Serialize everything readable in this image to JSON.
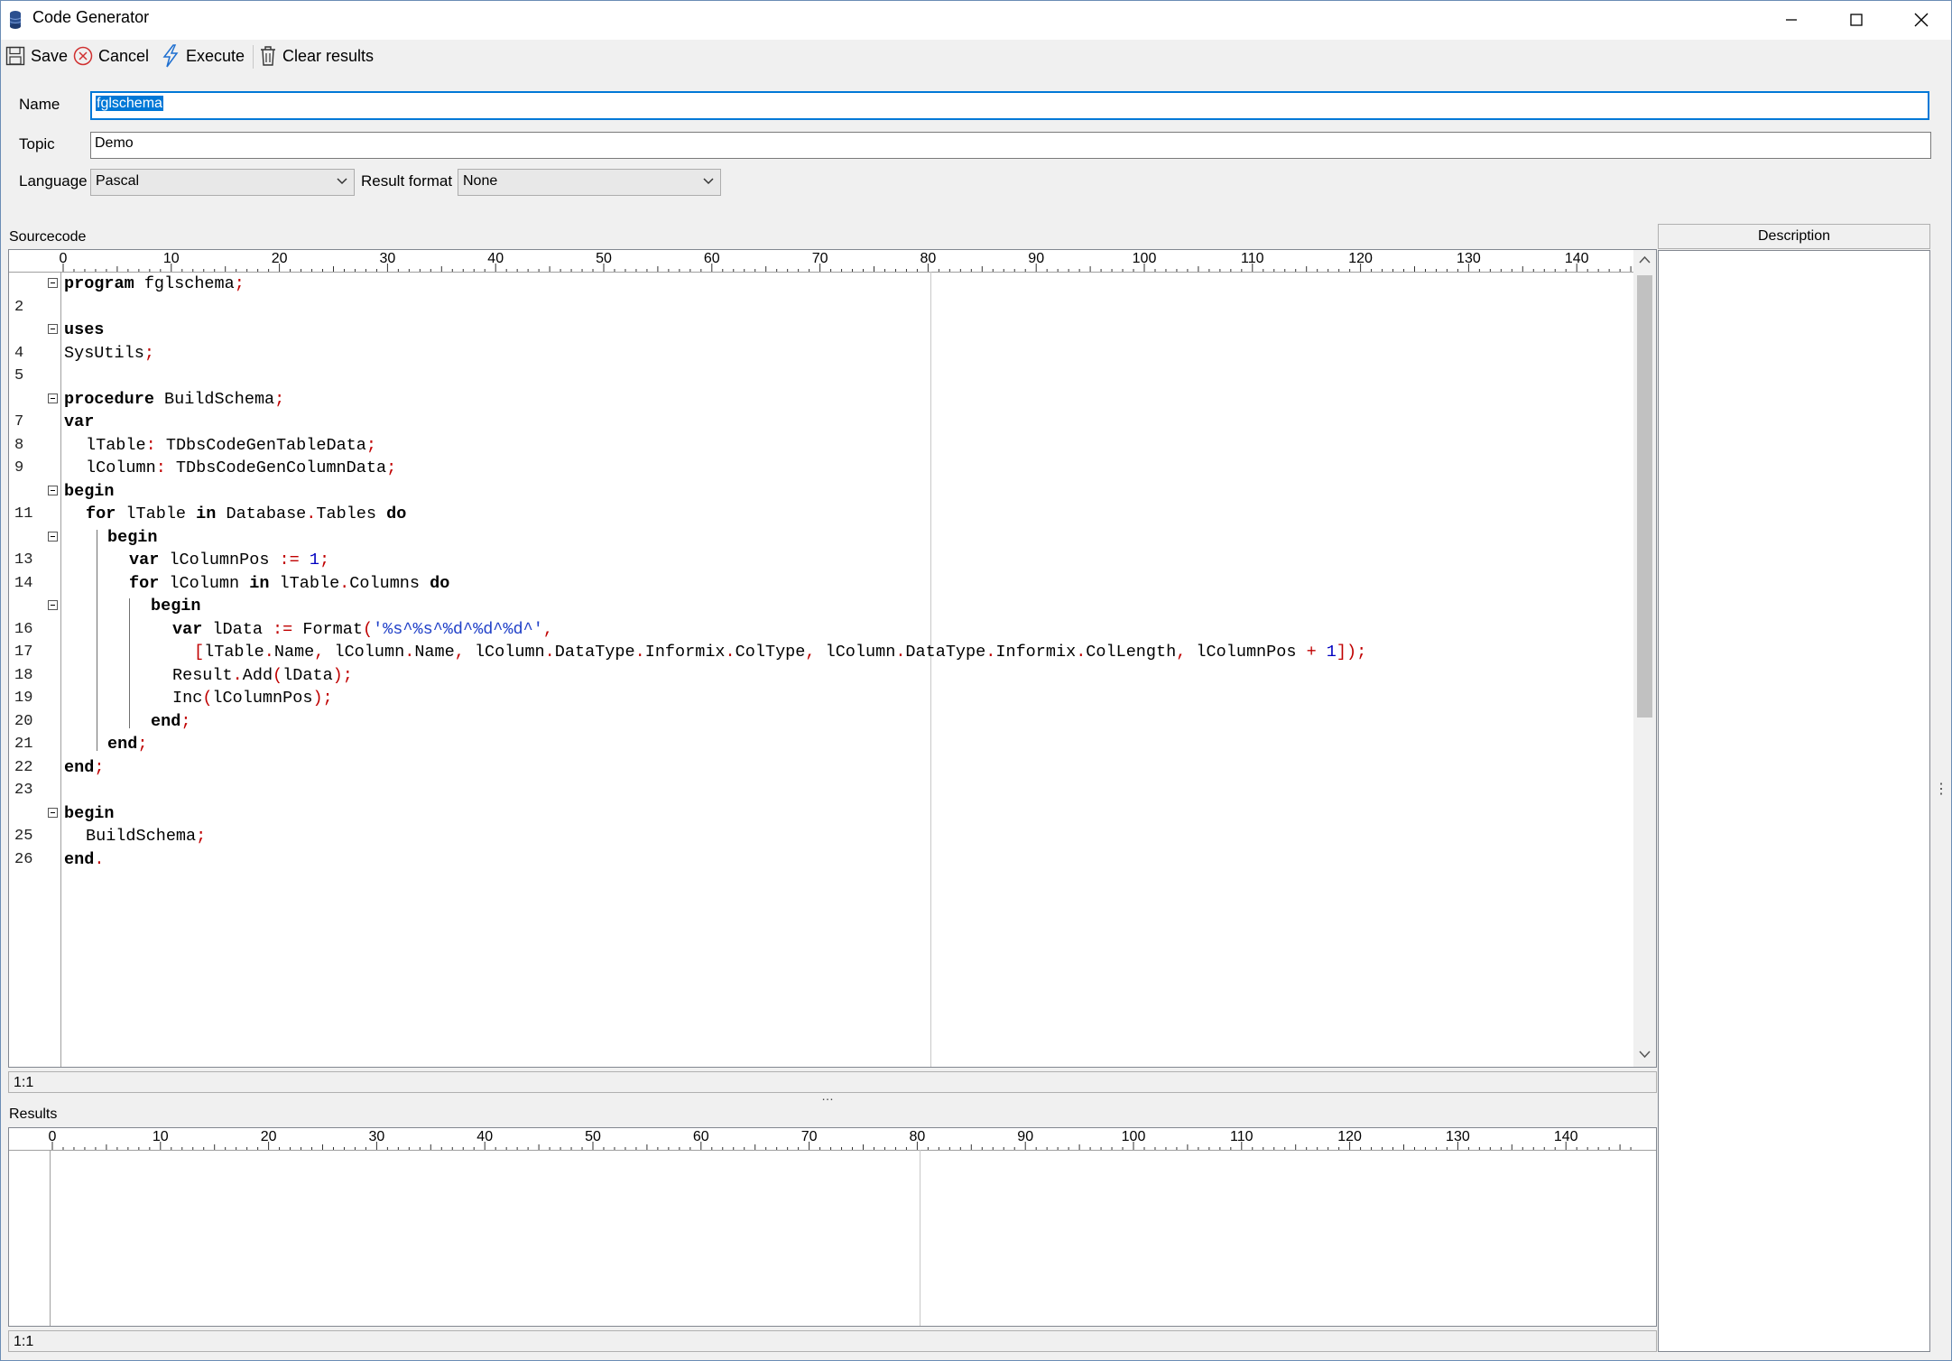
{
  "window": {
    "title": "Code Generator",
    "minimize_glyph": "—",
    "maximize_glyph": "☐",
    "close_glyph": "✕"
  },
  "toolbar": {
    "save_label": "Save",
    "cancel_label": "Cancel",
    "execute_label": "Execute",
    "clear_label": "Clear results"
  },
  "form": {
    "name_label": "Name",
    "name_value": "fglschema",
    "topic_label": "Topic",
    "topic_value": "Demo",
    "language_label": "Language",
    "language_value": "Pascal",
    "result_format_label": "Result format",
    "result_format_value": "None"
  },
  "source": {
    "label": "Sourcecode",
    "status": "1:1",
    "ruler_ticks": [
      "0",
      "10",
      "20",
      "30",
      "40",
      "50",
      "60",
      "70",
      "80",
      "90",
      "100",
      "110",
      "120",
      "130",
      "140"
    ],
    "lines": [
      {
        "n": "",
        "fold": true,
        "indent": 0,
        "tokens": [
          [
            "kw",
            "program"
          ],
          [
            "t",
            " fglschema"
          ],
          [
            "sym",
            ";"
          ]
        ]
      },
      {
        "n": "2",
        "fold": false,
        "indent": 0,
        "tokens": []
      },
      {
        "n": "",
        "fold": true,
        "indent": 0,
        "tokens": [
          [
            "kw",
            "uses"
          ]
        ]
      },
      {
        "n": "4",
        "fold": false,
        "indent": 0,
        "tokens": [
          [
            "t",
            "SysUtils"
          ],
          [
            "sym",
            ";"
          ]
        ]
      },
      {
        "n": "5",
        "fold": false,
        "indent": 0,
        "tokens": []
      },
      {
        "n": "",
        "fold": true,
        "indent": 0,
        "tokens": [
          [
            "kw",
            "procedure"
          ],
          [
            "t",
            " BuildSchema"
          ],
          [
            "sym",
            ";"
          ]
        ]
      },
      {
        "n": "7",
        "fold": false,
        "indent": 0,
        "tokens": [
          [
            "kw",
            "var"
          ]
        ]
      },
      {
        "n": "8",
        "fold": false,
        "indent": 2,
        "tokens": [
          [
            "t",
            "lTable"
          ],
          [
            "sym",
            ":"
          ],
          [
            "t",
            " TDbsCodeGenTableData"
          ],
          [
            "sym",
            ";"
          ]
        ]
      },
      {
        "n": "9",
        "fold": false,
        "indent": 2,
        "tokens": [
          [
            "t",
            "lColumn"
          ],
          [
            "sym",
            ":"
          ],
          [
            "t",
            " TDbsCodeGenColumnData"
          ],
          [
            "sym",
            ";"
          ]
        ]
      },
      {
        "n": "",
        "fold": true,
        "indent": 0,
        "tokens": [
          [
            "kw",
            "begin"
          ]
        ]
      },
      {
        "n": "11",
        "fold": false,
        "indent": 2,
        "tokens": [
          [
            "kw",
            "for"
          ],
          [
            "t",
            " lTable "
          ],
          [
            "kw",
            "in"
          ],
          [
            "t",
            " Database"
          ],
          [
            "sym",
            "."
          ],
          [
            "t",
            "Tables "
          ],
          [
            "kw",
            "do"
          ]
        ]
      },
      {
        "n": "",
        "fold": true,
        "indent": 4,
        "tokens": [
          [
            "kw",
            "begin"
          ]
        ]
      },
      {
        "n": "13",
        "fold": false,
        "indent": 6,
        "tokens": [
          [
            "kw",
            "var"
          ],
          [
            "t",
            " lColumnPos "
          ],
          [
            "sym",
            ":="
          ],
          [
            "t",
            " "
          ],
          [
            "num",
            "1"
          ],
          [
            "sym",
            ";"
          ]
        ]
      },
      {
        "n": "14",
        "fold": false,
        "indent": 6,
        "tokens": [
          [
            "kw",
            "for"
          ],
          [
            "t",
            " lColumn "
          ],
          [
            "kw",
            "in"
          ],
          [
            "t",
            " lTable"
          ],
          [
            "sym",
            "."
          ],
          [
            "t",
            "Columns "
          ],
          [
            "kw",
            "do"
          ]
        ]
      },
      {
        "n": "",
        "fold": true,
        "indent": 8,
        "tokens": [
          [
            "kw",
            "begin"
          ]
        ]
      },
      {
        "n": "16",
        "fold": false,
        "indent": 10,
        "tokens": [
          [
            "kw",
            "var"
          ],
          [
            "t",
            " lData "
          ],
          [
            "sym",
            ":="
          ],
          [
            "t",
            " Format"
          ],
          [
            "sym",
            "("
          ],
          [
            "str",
            "'%s^%s^%d^%d^%d^'"
          ],
          [
            "sym",
            ","
          ]
        ]
      },
      {
        "n": "17",
        "fold": false,
        "indent": 12,
        "tokens": [
          [
            "sym",
            "["
          ],
          [
            "t",
            "lTable"
          ],
          [
            "sym",
            "."
          ],
          [
            "t",
            "Name"
          ],
          [
            "sym",
            ","
          ],
          [
            "t",
            " lColumn"
          ],
          [
            "sym",
            "."
          ],
          [
            "t",
            "Name"
          ],
          [
            "sym",
            ","
          ],
          [
            "t",
            " lColumn"
          ],
          [
            "sym",
            "."
          ],
          [
            "t",
            "DataType"
          ],
          [
            "sym",
            "."
          ],
          [
            "t",
            "Informix"
          ],
          [
            "sym",
            "."
          ],
          [
            "t",
            "ColType"
          ],
          [
            "sym",
            ","
          ],
          [
            "t",
            " lColumn"
          ],
          [
            "sym",
            "."
          ],
          [
            "t",
            "DataType"
          ],
          [
            "sym",
            "."
          ],
          [
            "t",
            "Informix"
          ],
          [
            "sym",
            "."
          ],
          [
            "t",
            "ColLength"
          ],
          [
            "sym",
            ","
          ],
          [
            "t",
            " lColumnPos "
          ],
          [
            "sym",
            "+"
          ],
          [
            "t",
            " "
          ],
          [
            "num",
            "1"
          ],
          [
            "sym",
            "]);"
          ]
        ]
      },
      {
        "n": "18",
        "fold": false,
        "indent": 10,
        "tokens": [
          [
            "t",
            "Result"
          ],
          [
            "sym",
            "."
          ],
          [
            "t",
            "Add"
          ],
          [
            "sym",
            "("
          ],
          [
            "t",
            "lData"
          ],
          [
            "sym",
            ");"
          ]
        ]
      },
      {
        "n": "19",
        "fold": false,
        "indent": 10,
        "tokens": [
          [
            "t",
            "Inc"
          ],
          [
            "sym",
            "("
          ],
          [
            "t",
            "lColumnPos"
          ],
          [
            "sym",
            ");"
          ]
        ]
      },
      {
        "n": "20",
        "fold": false,
        "indent": 8,
        "tokens": [
          [
            "kw",
            "end"
          ],
          [
            "sym",
            ";"
          ]
        ]
      },
      {
        "n": "21",
        "fold": false,
        "indent": 4,
        "tokens": [
          [
            "kw",
            "end"
          ],
          [
            "sym",
            ";"
          ]
        ]
      },
      {
        "n": "22",
        "fold": false,
        "indent": 0,
        "tokens": [
          [
            "kw",
            "end"
          ],
          [
            "sym",
            ";"
          ]
        ]
      },
      {
        "n": "23",
        "fold": false,
        "indent": 0,
        "tokens": []
      },
      {
        "n": "",
        "fold": true,
        "indent": 0,
        "tokens": [
          [
            "kw",
            "begin"
          ]
        ]
      },
      {
        "n": "25",
        "fold": false,
        "indent": 2,
        "tokens": [
          [
            "t",
            "BuildSchema"
          ],
          [
            "sym",
            ";"
          ]
        ]
      },
      {
        "n": "26",
        "fold": false,
        "indent": 0,
        "tokens": [
          [
            "kw",
            "end"
          ],
          [
            "sym",
            "."
          ]
        ]
      }
    ]
  },
  "results": {
    "label": "Results",
    "status": "1:1",
    "splitter_glyph": "…"
  },
  "description": {
    "label": "Description",
    "splitter_glyph": "⋮"
  },
  "colors": {
    "selection": "#0078d7",
    "keyword": "#000000",
    "symbol": "#c00000",
    "string": "#2040c8",
    "number": "#0000c0"
  }
}
